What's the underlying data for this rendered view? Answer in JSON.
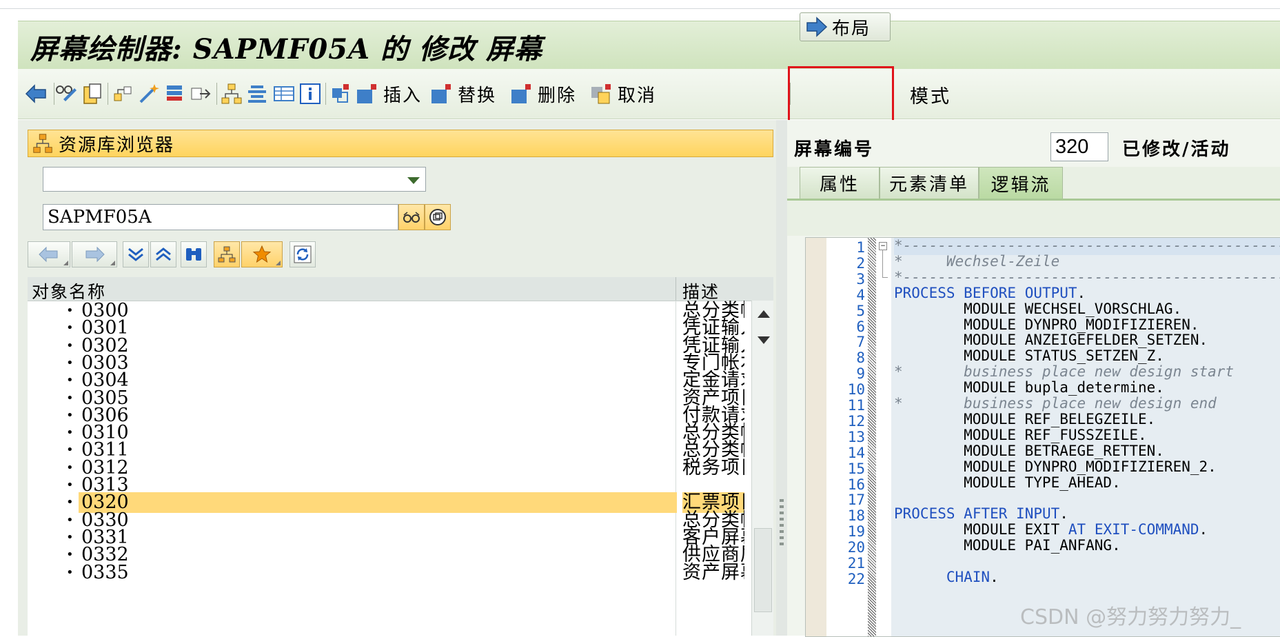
{
  "title": "屏幕绘制器: SAPMF05A 的 修改 屏幕",
  "toolbar": {
    "insert_label": "插入",
    "replace_label": "替换",
    "delete_label": "删除",
    "cancel_label": "取消",
    "layout_label": "布局",
    "mode_label": "模式"
  },
  "repository": {
    "header": "资源库浏览器",
    "combo_value": "",
    "object_name": "SAPMF05A",
    "columns": {
      "name": "对象名称",
      "desc": "描述"
    },
    "rows": [
      {
        "name": "0300",
        "desc": "总分类帐"
      },
      {
        "name": "0301",
        "desc": "凭证输入"
      },
      {
        "name": "0302",
        "desc": "凭证输入"
      },
      {
        "name": "0303",
        "desc": "专门帐本"
      },
      {
        "name": "0304",
        "desc": "定金请求"
      },
      {
        "name": "0305",
        "desc": "资产项目"
      },
      {
        "name": "0306",
        "desc": "付款请求"
      },
      {
        "name": "0310",
        "desc": "总分类帐"
      },
      {
        "name": "0311",
        "desc": "总分类帐"
      },
      {
        "name": "0312",
        "desc": "税务项目"
      },
      {
        "name": "0313",
        "desc": ""
      },
      {
        "name": "0320",
        "desc": "汇票项目",
        "selected": true
      },
      {
        "name": "0330",
        "desc": "总分类帐"
      },
      {
        "name": "0331",
        "desc": "客户屏幕"
      },
      {
        "name": "0332",
        "desc": "供应商屏"
      },
      {
        "name": "0335",
        "desc": "资产屏幕"
      }
    ]
  },
  "screen": {
    "number_label": "屏幕编号",
    "number": "320",
    "status": "已修改/活动",
    "tabs": [
      "属性",
      "元素清单",
      "逻辑流"
    ],
    "active_tab": "逻辑流"
  },
  "code_lines": [
    {
      "n": "1",
      "text": "*----------------------------------------------"
    },
    {
      "n": "2",
      "text": "*     Wechsel-Zeile"
    },
    {
      "n": "3",
      "text": "*----------------------------------------------"
    },
    {
      "n": "4",
      "text": "PROCESS BEFORE OUTPUT."
    },
    {
      "n": "5",
      "text": "        MODULE WECHSEL_VORSCHLAG."
    },
    {
      "n": "6",
      "text": "        MODULE DYNPRO_MODIFIZIEREN."
    },
    {
      "n": "7",
      "text": "        MODULE ANZEIGEFELDER_SETZEN."
    },
    {
      "n": "8",
      "text": "        MODULE STATUS_SETZEN_Z."
    },
    {
      "n": "9",
      "text": "*       business place new design start"
    },
    {
      "n": "10",
      "text": "        MODULE bupla_determine."
    },
    {
      "n": "11",
      "text": "*       business place new design end"
    },
    {
      "n": "12",
      "text": "        MODULE REF_BELEGZEILE."
    },
    {
      "n": "13",
      "text": "        MODULE REF_FUSSZEILE."
    },
    {
      "n": "14",
      "text": "        MODULE BETRAEGE_RETTEN."
    },
    {
      "n": "15",
      "text": "        MODULE DYNPRO_MODIFIZIEREN_2."
    },
    {
      "n": "16",
      "text": "        MODULE TYPE_AHEAD."
    },
    {
      "n": "17",
      "text": ""
    },
    {
      "n": "18",
      "text": "PROCESS AFTER INPUT."
    },
    {
      "n": "19",
      "text": "        MODULE EXIT AT EXIT-COMMAND."
    },
    {
      "n": "20",
      "text": "        MODULE PAI_ANFANG."
    },
    {
      "n": "21",
      "text": ""
    },
    {
      "n": "22",
      "text": "      CHAIN."
    }
  ],
  "watermark": "CSDN @努力努力努力_",
  "colors": {
    "title_bg": "#d8e8c9",
    "selection": "#ffd97a",
    "highlight_box": "#e0131a",
    "keyword": "#1f4fbf"
  }
}
